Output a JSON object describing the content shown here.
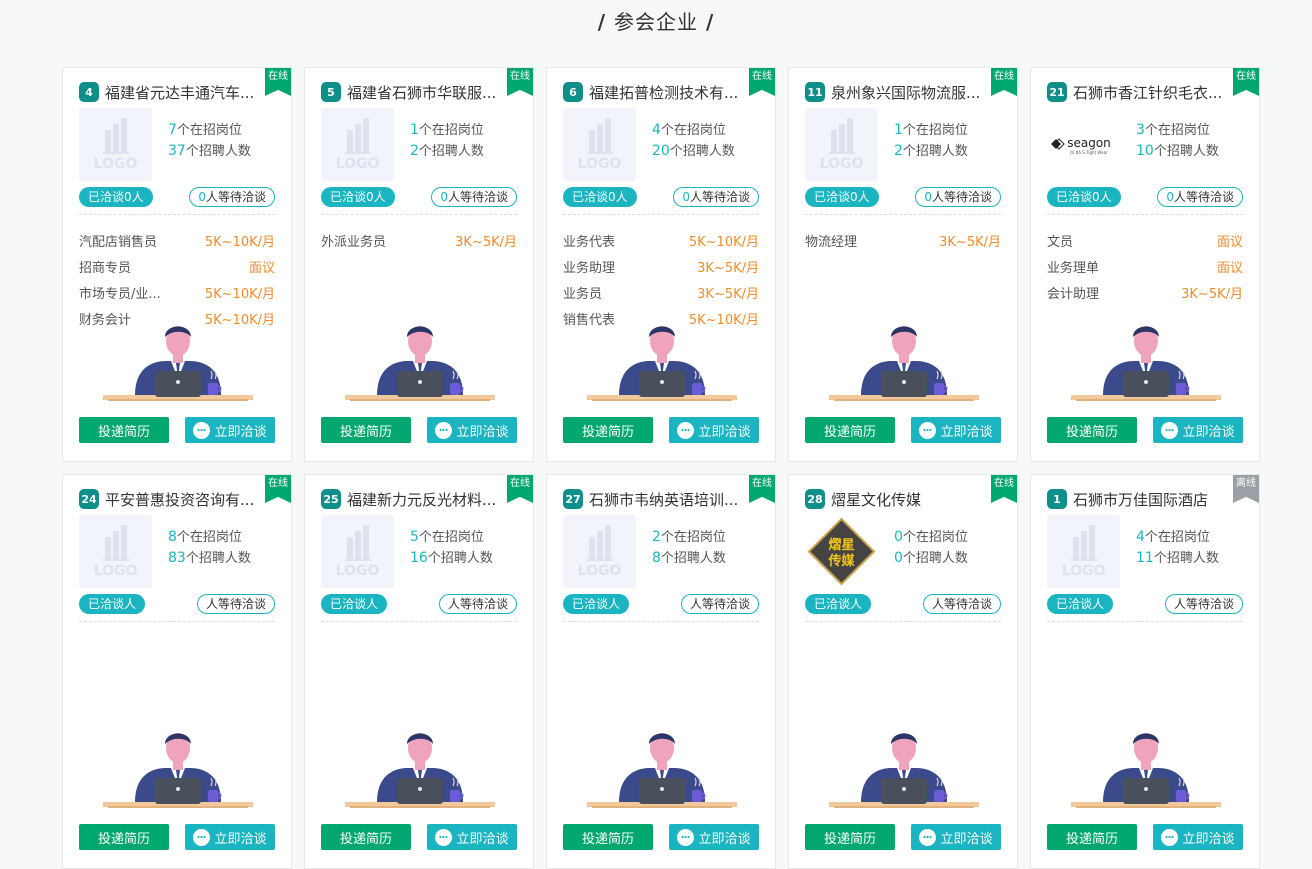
{
  "section": {
    "title": "参会企业",
    "slash_left": "/",
    "slash_right": "/"
  },
  "labels": {
    "positions_suffix": "个在招岗位",
    "headcount_suffix": "个招聘人数",
    "chatted_prefix": "已洽谈",
    "chatted_suffix": "人",
    "waiting_suffix": "人等待洽谈",
    "apply_button": "投递简历",
    "chat_button": "立即洽谈",
    "logo_text": "LOGO"
  },
  "colors": {
    "brand_green": "#00a870",
    "teal": "#1bb5c1",
    "salary_orange": "#f28c28",
    "offline_gray": "#9aa0a6"
  },
  "companies": [
    {
      "num": "4",
      "name": "福建省元达丰通汽车...",
      "status": "在线",
      "online": true,
      "logo": "placeholder",
      "positions": "7",
      "headcount": "37",
      "chatted": "0",
      "waiting": "0",
      "jobs": [
        {
          "title": "汽配店销售员",
          "salary": "5K~10K/月"
        },
        {
          "title": "招商专员",
          "salary": "面议"
        },
        {
          "title": "市场专员/业...",
          "salary": "5K~10K/月"
        },
        {
          "title": "财务会计",
          "salary": "5K~10K/月"
        }
      ]
    },
    {
      "num": "5",
      "name": "福建省石狮市华联服...",
      "status": "在线",
      "online": true,
      "logo": "placeholder",
      "positions": "1",
      "headcount": "2",
      "chatted": "0",
      "waiting": "0",
      "jobs": [
        {
          "title": "外派业务员",
          "salary": "3K~5K/月"
        }
      ]
    },
    {
      "num": "6",
      "name": "福建拓普检测技术有...",
      "status": "在线",
      "online": true,
      "logo": "placeholder",
      "positions": "4",
      "headcount": "20",
      "chatted": "0",
      "waiting": "0",
      "jobs": [
        {
          "title": "业务代表",
          "salary": "5K~10K/月"
        },
        {
          "title": "业务助理",
          "salary": "3K~5K/月"
        },
        {
          "title": "业务员",
          "salary": "3K~5K/月"
        },
        {
          "title": "销售代表",
          "salary": "5K~10K/月"
        }
      ]
    },
    {
      "num": "11",
      "name": "泉州象兴国际物流服...",
      "status": "在线",
      "online": true,
      "logo": "placeholder",
      "positions": "1",
      "headcount": "2",
      "chatted": "0",
      "waiting": "0",
      "jobs": [
        {
          "title": "物流经理",
          "salary": "3K~5K/月"
        }
      ]
    },
    {
      "num": "21",
      "name": "石狮市香江针织毛衣...",
      "status": "在线",
      "online": true,
      "logo": "seagon",
      "logo_word": "seagon",
      "logo_sub": "JU KA S.Tight Wear",
      "positions": "3",
      "headcount": "10",
      "chatted": "0",
      "waiting": "0",
      "jobs": [
        {
          "title": "文员",
          "salary": "面议"
        },
        {
          "title": "业务理单",
          "salary": "面议"
        },
        {
          "title": "会计助理",
          "salary": "3K~5K/月"
        }
      ]
    },
    {
      "num": "24",
      "name": "平安普惠投资咨询有...",
      "status": "在线",
      "online": true,
      "logo": "placeholder",
      "positions": "8",
      "headcount": "83",
      "chatted": "",
      "waiting": "",
      "jobs": []
    },
    {
      "num": "25",
      "name": "福建新力元反光材料...",
      "status": "在线",
      "online": true,
      "logo": "placeholder",
      "positions": "5",
      "headcount": "16",
      "chatted": "",
      "waiting": "",
      "jobs": []
    },
    {
      "num": "27",
      "name": "石狮市韦纳英语培训...",
      "status": "在线",
      "online": true,
      "logo": "placeholder",
      "positions": "2",
      "headcount": "8",
      "chatted": "",
      "waiting": "",
      "jobs": []
    },
    {
      "num": "28",
      "name": "熠星文化传媒",
      "status": "在线",
      "online": true,
      "logo": "yixing",
      "logo_line1": "熠星",
      "logo_line2": "传媒",
      "positions": "0",
      "headcount": "0",
      "chatted": "",
      "waiting": "",
      "jobs": []
    },
    {
      "num": "1",
      "name": "石狮市万佳国际酒店",
      "status": "离线",
      "online": false,
      "logo": "placeholder",
      "positions": "4",
      "headcount": "11",
      "chatted": "",
      "waiting": "",
      "jobs": []
    }
  ]
}
